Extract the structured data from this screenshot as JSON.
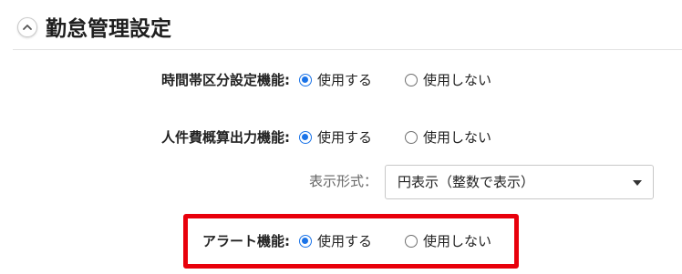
{
  "section": {
    "title": "勤怠管理設定",
    "collapse_icon": "chevron-up-icon"
  },
  "settings": [
    {
      "label": "時間帯区分設定機能:",
      "options": [
        "使用する",
        "使用しない"
      ],
      "selected": "使用する"
    },
    {
      "label": "人件費概算出力機能:",
      "options": [
        "使用する",
        "使用しない"
      ],
      "selected": "使用する"
    },
    {
      "label": "アラート機能:",
      "options": [
        "使用する",
        "使用しない"
      ],
      "selected": "使用する"
    }
  ],
  "display_format": {
    "label": "表示形式：",
    "selected_value": "円表示（整数で表示）"
  },
  "colors": {
    "accent": "#1a73e8",
    "highlight": "#e8000b"
  }
}
